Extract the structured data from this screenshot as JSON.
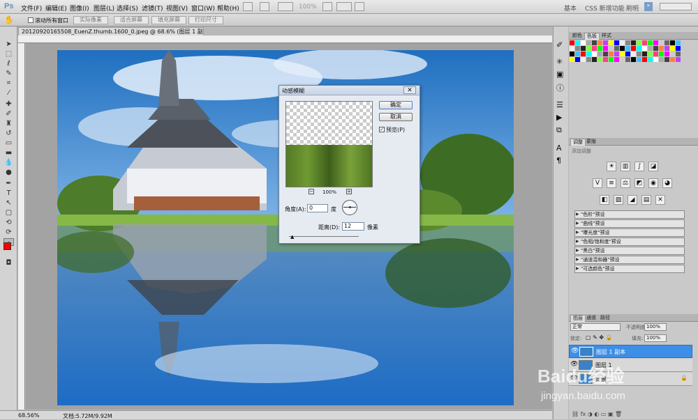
{
  "app": {
    "logo": "Ps",
    "menus": [
      "文件(F)",
      "编辑(E)",
      "图像(I)",
      "图层(L)",
      "选择(S)",
      "滤镜(T)",
      "视图(V)",
      "窗口(W)",
      "帮助(H)"
    ],
    "zoom": "100%",
    "workspaces": [
      "基本",
      "CSS 新增功能",
      "刷明"
    ]
  },
  "options": {
    "scroll_all": "滚动所有窗口",
    "buttons": [
      "实际像素",
      "适合屏幕",
      "填充屏幕",
      "打印尺寸"
    ]
  },
  "document": {
    "tab": "20120920165508_EuenZ.thumb.1600_0.jpeg @ 68.6% (图层 1 副本, RGB/8#) *",
    "zoom": "68.56%",
    "doc_size": "文档:5.72M/9.92M"
  },
  "dialog": {
    "title": "动感模糊",
    "ok": "确定",
    "cancel": "取消",
    "preview": "预览(P)",
    "zoom": "100%",
    "angle_label": "角度(A):",
    "angle_value": "0",
    "angle_unit": "度",
    "distance_label": "距离(D):",
    "distance_value": "12",
    "distance_unit": "像素"
  },
  "swatch_tabs": [
    "颜色",
    "色板",
    "样式"
  ],
  "adjust_tabs": [
    "调整",
    "蒙版"
  ],
  "adjust_title": "添加调整",
  "presets": [
    "\"色阶\"预设",
    "\"曲线\"预设",
    "\"曝光度\"预设",
    "\"色相/饱和度\"预设",
    "\"黑白\"预设",
    "\"通道混和器\"预设",
    "\"可选颜色\"预设"
  ],
  "layers": {
    "tabs": [
      "图层",
      "通道",
      "路径"
    ],
    "blend": "正常",
    "opacity_label": "不透明度:",
    "opacity": "100%",
    "lock_label": "锁定:",
    "fill_label": "填充:",
    "fill": "100%",
    "items": [
      {
        "name": "图层 1 副本"
      },
      {
        "name": "图层 1"
      },
      {
        "name": "背景"
      }
    ]
  },
  "watermark": {
    "text": "Baidu经验",
    "url": "jingyan.baidu.com"
  },
  "colors": {
    "fg": "#ff0000",
    "bg": "#ffffff",
    "selected_layer": "#3d8ee6"
  }
}
